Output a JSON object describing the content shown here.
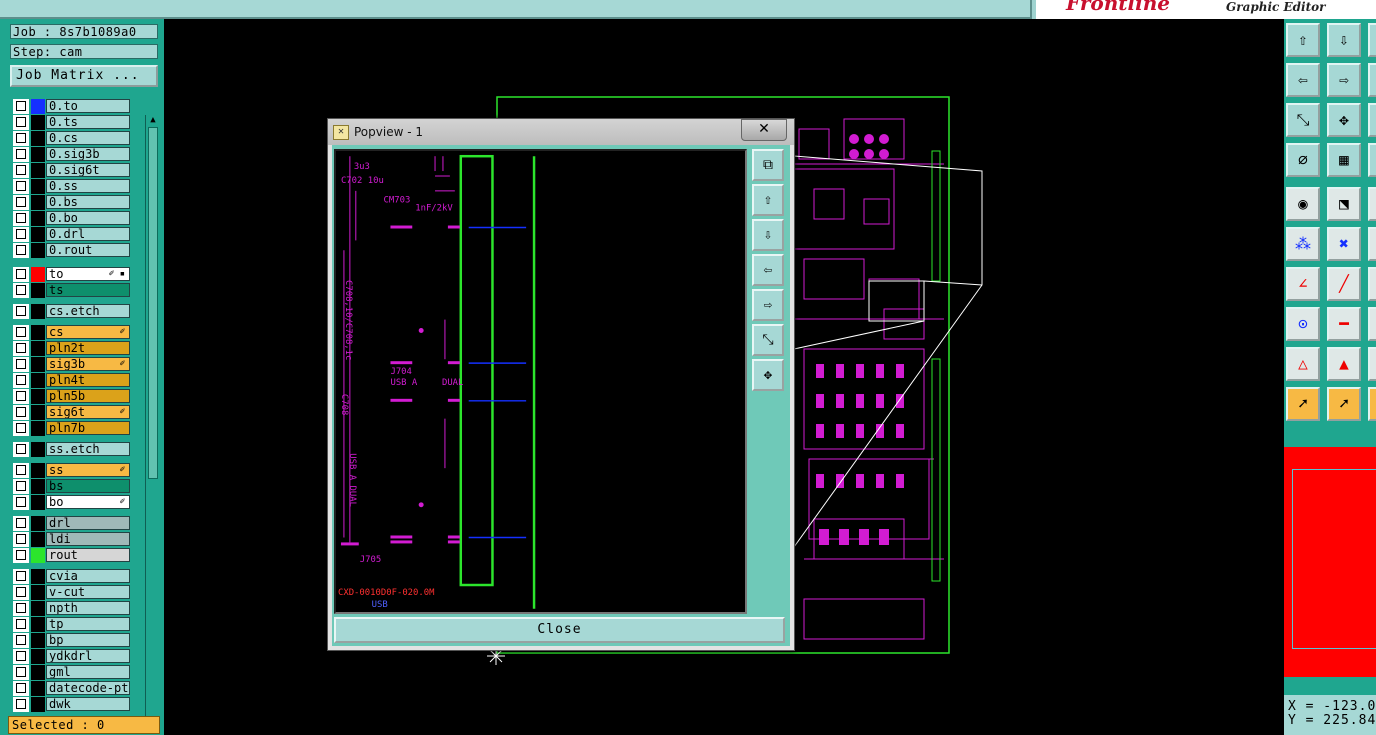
{
  "app": {
    "brand": "Frontline",
    "subtitle": "Graphic Editor"
  },
  "job": {
    "job_label": "Job : 8s7b1089a0",
    "step_label": "Step: cam",
    "matrix_button": "Job Matrix ..."
  },
  "layers": [
    {
      "name": "0.to",
      "color": "#1530ff"
    },
    {
      "name": "0.ts",
      "color": "#000000"
    },
    {
      "name": "0.cs",
      "color": "#000000"
    },
    {
      "name": "0.sig3b",
      "color": "#000000"
    },
    {
      "name": "0.sig6t",
      "color": "#000000"
    },
    {
      "name": "0.ss",
      "color": "#000000"
    },
    {
      "name": "0.bs",
      "color": "#000000"
    },
    {
      "name": "0.bo",
      "color": "#000000"
    },
    {
      "name": "0.drl",
      "color": "#000000"
    },
    {
      "name": "0.rout",
      "color": "#000000"
    },
    {
      "name": "to",
      "color": "#ff0000",
      "bg": "#ffffff",
      "mark": "✐ ▪"
    },
    {
      "name": "ts",
      "color": "#000000",
      "bg": "#0e8f6c"
    },
    {
      "name": "cs.etch",
      "color": "#000000"
    },
    {
      "name": "cs",
      "color": "#000000",
      "bg": "#f7b944",
      "mark": "✐"
    },
    {
      "name": "pln2t",
      "color": "#000000",
      "bg": "#dba21a"
    },
    {
      "name": "sig3b",
      "color": "#000000",
      "bg": "#f7b944",
      "mark": "✐"
    },
    {
      "name": "pln4t",
      "color": "#000000",
      "bg": "#dba21a"
    },
    {
      "name": "pln5b",
      "color": "#000000",
      "bg": "#dba21a"
    },
    {
      "name": "sig6t",
      "color": "#000000",
      "bg": "#f7b944",
      "mark": "✐"
    },
    {
      "name": "pln7b",
      "color": "#000000",
      "bg": "#dba21a"
    },
    {
      "name": "ss.etch",
      "color": "#000000"
    },
    {
      "name": "ss",
      "color": "#000000",
      "bg": "#f7b944",
      "mark": "✐"
    },
    {
      "name": "bs",
      "color": "#000000",
      "bg": "#0e8f6c"
    },
    {
      "name": "bo",
      "color": "#000000",
      "bg": "#ffffff",
      "mark": "✐"
    },
    {
      "name": "drl",
      "color": "#000000",
      "bg": "#9fb9b8"
    },
    {
      "name": "ldi",
      "color": "#000000",
      "bg": "#9fb9b8"
    },
    {
      "name": "rout",
      "color": "#2ce52c",
      "bg": "#d6d6d6"
    },
    {
      "name": "cvia",
      "color": "#000000"
    },
    {
      "name": "v-cut",
      "color": "#000000"
    },
    {
      "name": "npth",
      "color": "#000000"
    },
    {
      "name": "tp",
      "color": "#000000"
    },
    {
      "name": "bp",
      "color": "#000000"
    },
    {
      "name": "ydkdrl",
      "color": "#000000"
    },
    {
      "name": "gml",
      "color": "#000000"
    },
    {
      "name": "datecode-pt",
      "color": "#000000"
    },
    {
      "name": "dwk",
      "color": "#000000"
    }
  ],
  "status": {
    "selected": "Selected : 0"
  },
  "coords": {
    "x": "X = -123.0",
    "y": "Y = 225.84"
  },
  "popup": {
    "title": "Popview - 1",
    "close_x": "✕",
    "close_button": "Close"
  },
  "board_labels": {
    "l1": "3u3",
    "l2": "C702 10u",
    "l3": "CM703",
    "l4": "1nF/2kV",
    "l5": "J704",
    "l6": "USB A",
    "l7": "DUAL",
    "l8": "C708,10/C708,1c",
    "l9": "USB A DUAL",
    "l10": "C708",
    "l11": "J705",
    "l12": "CXD-0010D0F-020.0M",
    "l13": "USB"
  }
}
